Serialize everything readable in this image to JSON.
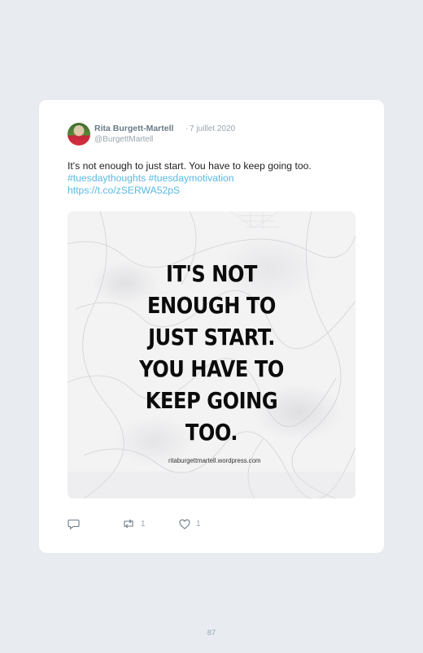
{
  "tweet": {
    "author_name": "Rita Burgett-Martell",
    "separator": "·",
    "date": "7 juillet 2020",
    "handle": "@BurgettMartell",
    "text_line": "It's not enough to just start. You have to keep going too.",
    "hashtags": "#tuesdaythoughts #tuesdaymotivation",
    "link": "https://t.co/zSERWA52pS",
    "media": {
      "quote_lines": [
        "IT'S NOT",
        "ENOUGH TO",
        "JUST START.",
        "YOU HAVE TO",
        "KEEP GOING",
        "TOO."
      ],
      "site": "ritaburgettmartell.wordpress.com"
    },
    "actions": {
      "reply_icon": "reply-icon",
      "retweet_icon": "retweet-icon",
      "retweet_count": "1",
      "like_icon": "heart-icon",
      "like_count": "1"
    },
    "colors": {
      "link": "#5bb8e3",
      "meta": "#9aa6ae",
      "name": "#6b7b86"
    }
  },
  "page": {
    "number": "87"
  }
}
